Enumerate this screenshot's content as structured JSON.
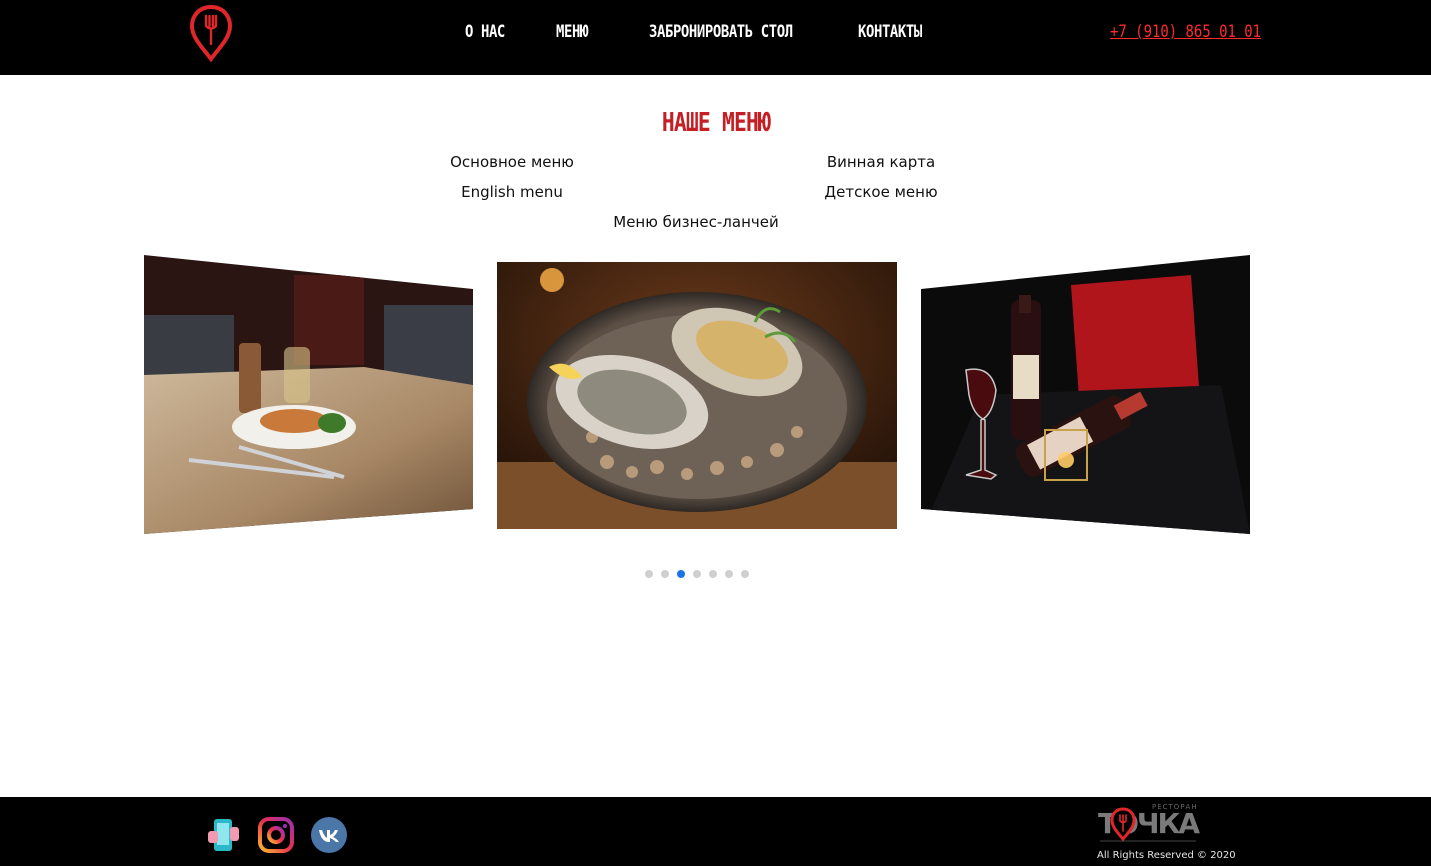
{
  "header": {
    "nav": [
      {
        "label": "О НАС"
      },
      {
        "label": "МЕНЮ"
      },
      {
        "label": "ЗАБРОНИРОВАТЬ СТОЛ"
      },
      {
        "label": "КОНТАКТЫ"
      }
    ],
    "phone": "+7 (910) 865 01 01"
  },
  "menu_section": {
    "title": "НАШЕ МЕНЮ",
    "links": [
      {
        "label": "Основное меню"
      },
      {
        "label": "Винная карта"
      },
      {
        "label": "English menu"
      },
      {
        "label": "Детское меню"
      },
      {
        "label": "Меню бизнес-ланчей"
      }
    ]
  },
  "carousel": {
    "slides": [
      {
        "icon": "plated-dish-photo"
      },
      {
        "icon": "oysters-photo"
      },
      {
        "icon": "wine-bottle-photo"
      }
    ],
    "dots_total": 7,
    "active_dot": 3
  },
  "footer": {
    "social": [
      {
        "icon": "app-icon"
      },
      {
        "icon": "instagram-icon"
      },
      {
        "icon": "vk-icon"
      }
    ],
    "brand": {
      "small": "РЕСТОРАН",
      "name": "ТОЧКА"
    },
    "rights": "All Rights Reserved © 2020"
  },
  "colors": {
    "accent": "#c41f24",
    "phone": "#ff2a2a",
    "header_bg": "#000000",
    "dot_active": "#1a73e8",
    "dot_inactive": "#cfcfcf"
  }
}
